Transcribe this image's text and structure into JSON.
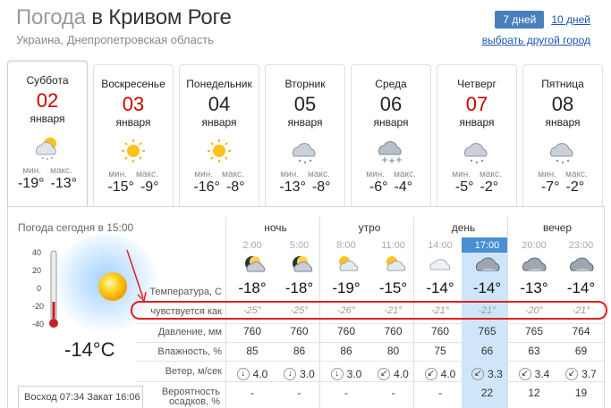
{
  "header": {
    "title_prefix": "Погода",
    "title_city": "в Кривом Роге",
    "region": "Украина, Днепропетровская область",
    "range_active": "7 дней",
    "range_alt": "10 дней",
    "choose_city": "выбрать другой город"
  },
  "labels": {
    "min": "мин.",
    "max": "макс."
  },
  "days": [
    {
      "dow": "Суббота",
      "num": "02",
      "month": "января",
      "min": "-19°",
      "max": "-13°",
      "red": true,
      "icon": "sun-cloud-snow-icon"
    },
    {
      "dow": "Воскресенье",
      "num": "03",
      "month": "января",
      "min": "-15°",
      "max": "-9°",
      "red": true,
      "icon": "sun-icon"
    },
    {
      "dow": "Понедельник",
      "num": "04",
      "month": "января",
      "min": "-16°",
      "max": "-8°",
      "red": false,
      "icon": "sun-icon"
    },
    {
      "dow": "Вторник",
      "num": "05",
      "month": "января",
      "min": "-13°",
      "max": "-8°",
      "red": false,
      "icon": "cloud-snow-icon"
    },
    {
      "dow": "Среда",
      "num": "06",
      "month": "января",
      "min": "-6°",
      "max": "-4°",
      "red": false,
      "icon": "heavy-snow-icon"
    },
    {
      "dow": "Четверг",
      "num": "07",
      "month": "января",
      "min": "-5°",
      "max": "-2°",
      "red": true,
      "icon": "cloud-snow-icon"
    },
    {
      "dow": "Пятница",
      "num": "08",
      "month": "января",
      "min": "-7°",
      "max": "-2°",
      "red": false,
      "icon": "cloud-snow-icon"
    }
  ],
  "today": {
    "label": "Погода сегодня в 15:00",
    "temp": "-14°C",
    "scale": [
      "40",
      "20",
      "0",
      "-20",
      "-40"
    ],
    "sunrise_label": "Восход",
    "sunrise": "07:34",
    "sunset_label": "Закат",
    "sunset": "16:06"
  },
  "periods": [
    "ночь",
    "утро",
    "день",
    "вечер"
  ],
  "hours": [
    "2:00",
    "5:00",
    "8:00",
    "11:00",
    "14:00",
    "17:00",
    "20:00",
    "23:00"
  ],
  "current_hour_index": 5,
  "hour_icons": [
    "moon-cloud-icon",
    "moon-cloud-icon",
    "sun-cloud-icon",
    "sun-cloud-icon",
    "cloud-icon",
    "dark-cloud-icon",
    "dark-cloud-icon",
    "dark-cloud-icon"
  ],
  "row_labels": {
    "temp": "Температура, С",
    "feels": "чувствуется как",
    "pressure": "Давление, мм",
    "humidity": "Влажность, %",
    "wind": "Ветер, м/сек",
    "precip": "Вероятность осадков, %"
  },
  "rows": {
    "temp": [
      "-18°",
      "-18°",
      "-19°",
      "-15°",
      "-14°",
      "-14°",
      "-13°",
      "-14°"
    ],
    "feels": [
      "-25°",
      "-25°",
      "-26°",
      "-21°",
      "-21°",
      "-21°",
      "-20°",
      "-21°"
    ],
    "pressure": [
      "760",
      "760",
      "760",
      "760",
      "760",
      "765",
      "765",
      "764"
    ],
    "humidity": [
      "85",
      "86",
      "86",
      "80",
      "75",
      "66",
      "63",
      "69"
    ],
    "wind_dir": [
      "↓",
      "↓",
      "↓",
      "↙",
      "↙",
      "↙",
      "↙",
      "↙"
    ],
    "wind": [
      "4.0",
      "3.0",
      "3.0",
      "4.0",
      "4.0",
      "3.3",
      "3.4",
      "3.7"
    ],
    "precip": [
      "-",
      "-",
      "-",
      "-",
      "-",
      "22",
      "12",
      "19"
    ]
  },
  "colors": {
    "accent": "#4a7fbe",
    "link": "#1a55b8",
    "highlight": "#cfe6fa",
    "red": "#cc0000",
    "annotation": "#e02020"
  }
}
